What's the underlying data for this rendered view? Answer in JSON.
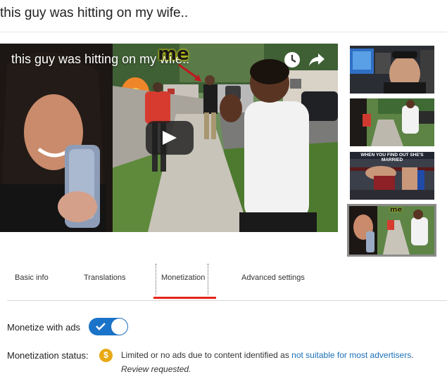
{
  "page": {
    "title": "this guy was hitting on my wife.."
  },
  "player": {
    "video_title": "this guy was hitting on my wife..",
    "overlay_text": "me",
    "icons": [
      "watch-later-icon",
      "share-icon",
      "play-icon"
    ]
  },
  "thumbnails": [
    {
      "name": "thumbnail-1",
      "caption": ""
    },
    {
      "name": "thumbnail-2",
      "caption": ""
    },
    {
      "name": "thumbnail-3",
      "caption": "WHEN YOU FIND OUT SHE'S MARRIED"
    },
    {
      "name": "thumbnail-4",
      "caption": "me",
      "selected": true
    }
  ],
  "tabs": [
    {
      "label": "Basic info",
      "active": false
    },
    {
      "label": "Translations",
      "active": false
    },
    {
      "label": "Monetization",
      "active": true
    },
    {
      "label": "Advanced settings",
      "active": false
    }
  ],
  "monetization": {
    "monetize_label": "Monetize with ads",
    "toggle_on": true,
    "status_label": "Monetization status:",
    "status_icon": "$",
    "status_text": "Limited or no ads due to content identified as ",
    "status_link": "not suitable for most advertisers",
    "status_end": ".",
    "status_note": "Review requested."
  },
  "colors": {
    "accent_blue": "#1a73c8",
    "tab_indicator": "#e5261c",
    "dollar_icon": "#e8a913",
    "link": "#1a6fb8"
  }
}
